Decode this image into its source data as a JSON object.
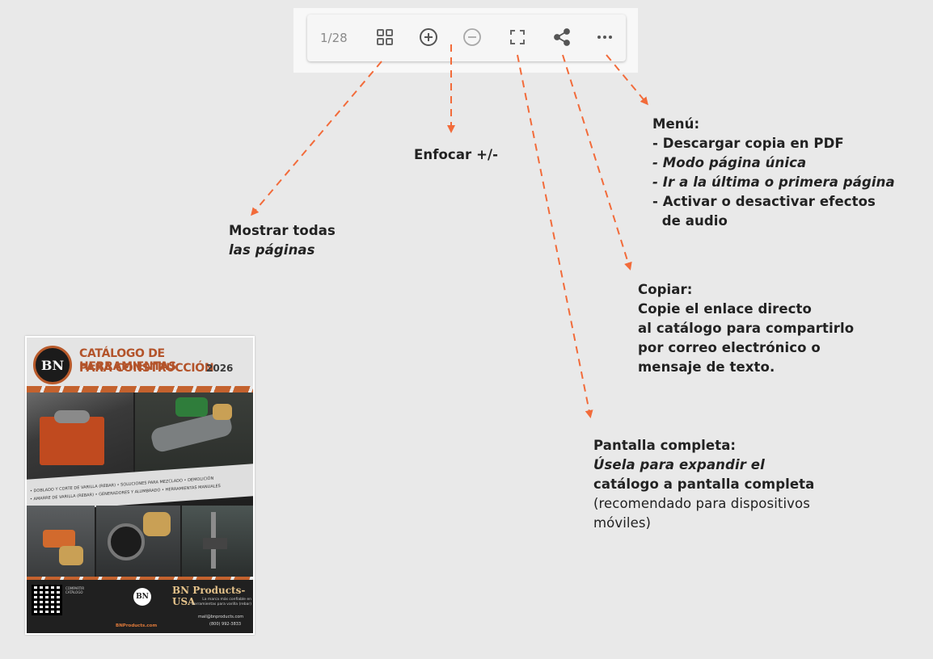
{
  "toolbar": {
    "page_counter": "1/28",
    "icons": [
      "grid-icon",
      "zoom-in-icon",
      "zoom-out-icon",
      "fullscreen-icon",
      "share-icon",
      "more-icon"
    ]
  },
  "annotations": {
    "show_all": {
      "line1": "Mostrar todas",
      "line2": "las páginas"
    },
    "zoom": {
      "line1": "Enfocar +/-"
    },
    "menu": {
      "title": "Menú:",
      "items": [
        "- Descargar copia en PDF",
        "- Modo página única",
        "- Ir a la última o primera página",
        "- Activar o desactivar efectos",
        "  de audio"
      ]
    },
    "copy": {
      "title": "Copiar:",
      "lines": [
        "Copie el enlace directo",
        "al catálogo para compartirlo",
        "por correo electrónico o",
        "mensaje de texto."
      ]
    },
    "fullscreen": {
      "title": "Pantalla completa:",
      "lines": [
        "Úsela para expandir el",
        "catálogo a pantalla completa"
      ],
      "note_lines": [
        "(recomendado para dispositivos",
        "móviles)"
      ]
    }
  },
  "catalog": {
    "logo": "BN",
    "title_line1": "CATÁLOGO DE HERRAMIENTAS",
    "title_line2": "PARA CONSTRUCCIÓN",
    "year": "2026",
    "categories_row1": "• DOBLADO Y CORTE DE VARILLA (REBAR)   • SOLUCIONES PARA MEZCLADO   • DEMOLICIÓN",
    "categories_row2": "• AMARRE DE VARILLA (REBAR)   • GENERADORES Y ALUMBRADO   • HERRAMIENTAS MANUALES",
    "brand": "BN Products-USA",
    "tagline": "La marca más confiable en herramientas para varilla (rebar)",
    "email": "mail@bnproducts.com",
    "phone": "(800) 992-3833",
    "website": "BNProducts.com",
    "share_label": "COMPARTIR CATÁLOGO",
    "accent_color": "#b3532a"
  },
  "colors": {
    "arrow": "#f26b3a",
    "background": "#e9e9e9"
  }
}
